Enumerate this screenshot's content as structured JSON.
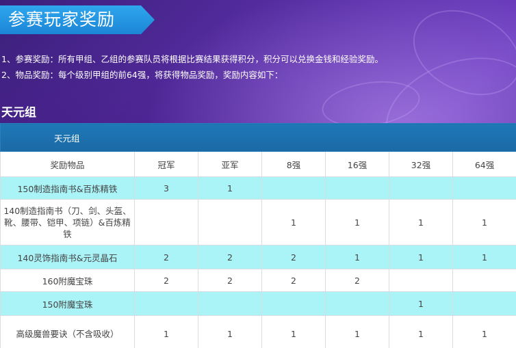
{
  "title": "参赛玩家奖励",
  "desc": [
    "1、参赛奖励：所有甲组、乙组的参赛队员将根据比赛结果获得积分，积分可以兑换金钱和经验奖励。",
    "2、物品奖励：每个级别甲组的前64强，将获得物品奖励，奖励内容如下："
  ],
  "group_title": "天元组",
  "table": {
    "group_label": "天元组",
    "headers": [
      "奖励物品",
      "冠军",
      "亚军",
      "8强",
      "16强",
      "32强",
      "64强"
    ],
    "rows": [
      [
        "150制造指南书&百炼精铁",
        "3",
        "1",
        "",
        "",
        "",
        ""
      ],
      [
        "140制造指南书（刀、剑、头盔、靴、腰带、铠甲、项链）&百炼精铁",
        "",
        "",
        "1",
        "1",
        "1",
        "1"
      ],
      [
        "140灵饰指南书&元灵晶石",
        "2",
        "2",
        "2",
        "1",
        "1",
        "1"
      ],
      [
        "160附魔宝珠",
        "2",
        "2",
        "2",
        "2",
        "",
        ""
      ],
      [
        "150附魔宝珠",
        "",
        "",
        "",
        "",
        "1",
        ""
      ],
      [
        "高级魔兽要诀（不含吸收）",
        "1",
        "1",
        "1",
        "1",
        "1",
        "1"
      ]
    ]
  }
}
